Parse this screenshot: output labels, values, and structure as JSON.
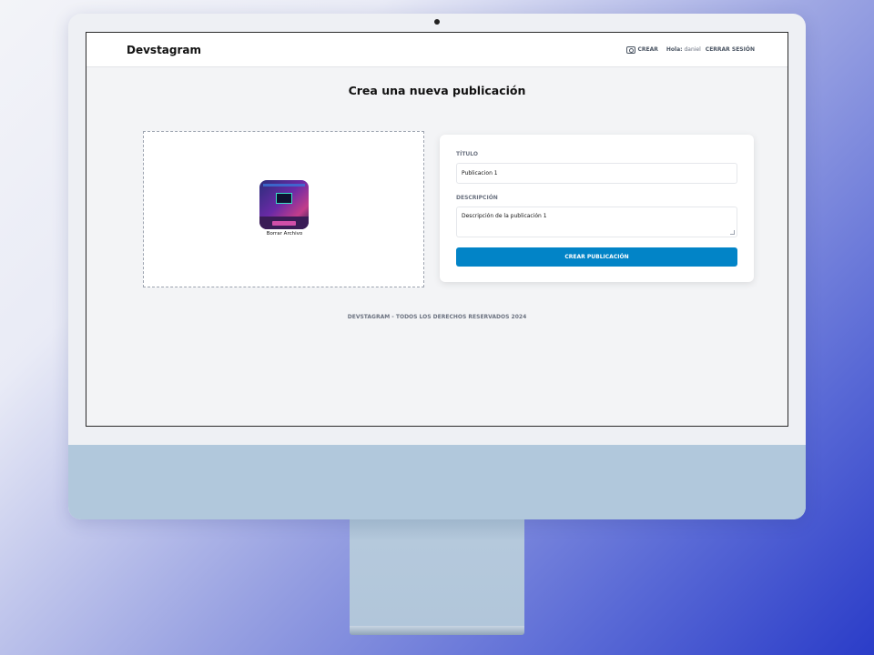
{
  "app": {
    "brand": "Devstagram"
  },
  "nav": {
    "create_label": "Crear",
    "greeting": "Hola:",
    "username": "daniel",
    "logout_label": "Cerrar Sesión"
  },
  "page": {
    "title": "Crea una nueva publicación"
  },
  "upload": {
    "remove_label": "Borrar Archivo"
  },
  "form": {
    "title_label": "Título",
    "title_value": "Publicacion 1",
    "description_label": "Descripción",
    "description_value": "Descripción de la publicación 1",
    "submit_label": "Crear Publicación"
  },
  "footer": {
    "text": "Devstagram - Todos los derechos reservados 2024"
  },
  "colors": {
    "primary": "#0284c7",
    "screen_bg": "#f3f4f6",
    "imac_chin": "#b1c8dc"
  }
}
